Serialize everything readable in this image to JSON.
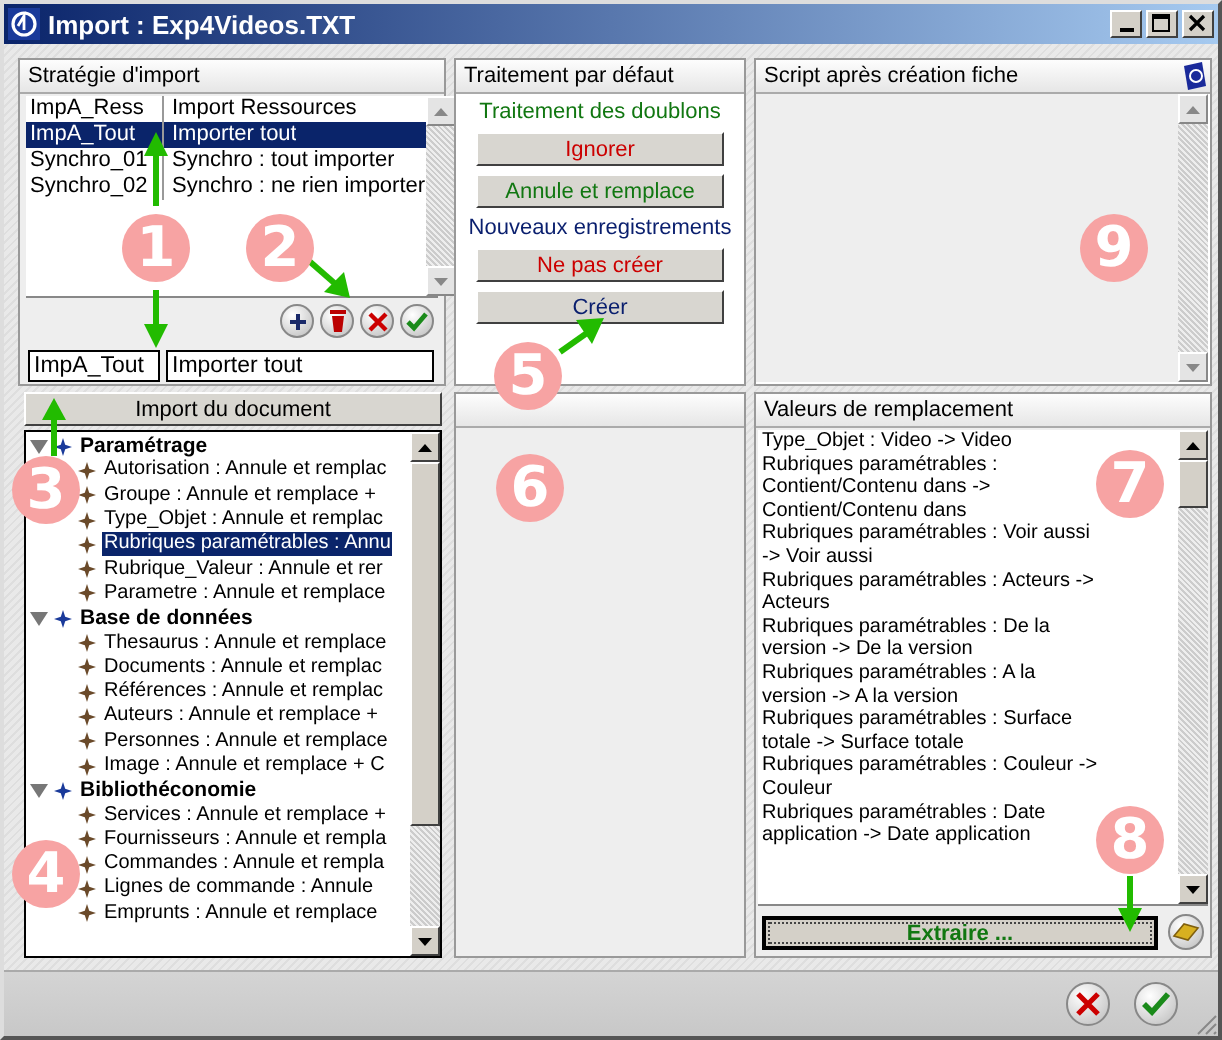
{
  "window": {
    "title": "Import : Exp4Videos.TXT"
  },
  "strategy": {
    "title": "Stratégie d'import",
    "rows": [
      {
        "code": "ImpA_Ress",
        "label": "Import Ressources",
        "selected": false
      },
      {
        "code": "ImpA_Tout",
        "label": "Importer tout",
        "selected": true
      },
      {
        "code": "Synchro_01",
        "label": "Synchro : tout importer",
        "selected": false
      },
      {
        "code": "Synchro_02",
        "label": "Synchro : ne rien importer",
        "selected": false
      }
    ],
    "code_field": {
      "value": "ImpA_Tout"
    },
    "label_field": {
      "value": "Importer tout"
    }
  },
  "defaults": {
    "title": "Traitement par défaut",
    "items": [
      {
        "kind": "label",
        "text": "Traitement des doublons",
        "color": "#117711"
      },
      {
        "kind": "button",
        "text": "Ignorer",
        "color": "#cc0000"
      },
      {
        "kind": "button",
        "text": "Annule et remplace",
        "color": "#117711"
      },
      {
        "kind": "label",
        "text": "Nouveaux enregistrements",
        "color": "#0a1f6e"
      },
      {
        "kind": "button",
        "text": "Ne pas créer",
        "color": "#cc0000"
      },
      {
        "kind": "button",
        "text": "Créer",
        "color": "#0a1f6e"
      }
    ]
  },
  "script": {
    "title": "Script après création fiche"
  },
  "import_button": "Import du document",
  "tree": [
    {
      "label": "Paramétrage",
      "expanded": true,
      "selected": false,
      "children": [
        {
          "label": "Autorisation : Annule et remplac",
          "selected": false
        },
        {
          "label": "Groupe : Annule et remplace +",
          "selected": false
        },
        {
          "label": "Type_Objet : Annule et remplac",
          "selected": false
        },
        {
          "label": "Rubriques paramétrables : Annu",
          "selected": true
        },
        {
          "label": "Rubrique_Valeur : Annule et rer",
          "selected": false
        },
        {
          "label": "Parametre : Annule et remplace",
          "selected": false
        }
      ]
    },
    {
      "label": "Base de données",
      "expanded": true,
      "selected": false,
      "children": [
        {
          "label": "Thesaurus : Annule et remplace",
          "selected": false
        },
        {
          "label": "Documents : Annule et remplac",
          "selected": false
        },
        {
          "label": "Références : Annule et remplac",
          "selected": false
        },
        {
          "label": "Auteurs : Annule et remplace +",
          "selected": false
        },
        {
          "label": "Personnes : Annule et remplace",
          "selected": false
        },
        {
          "label": "Image : Annule et remplace + C",
          "selected": false
        }
      ]
    },
    {
      "label": "Bibliothéconomie",
      "expanded": true,
      "selected": false,
      "children": [
        {
          "label": "Services : Annule et remplace +",
          "selected": false
        },
        {
          "label": "Fournisseurs : Annule et rempla",
          "selected": false
        },
        {
          "label": "Commandes : Annule et rempla",
          "selected": false
        },
        {
          "label": "Lignes de commande : Annule",
          "selected": false
        },
        {
          "label": "Emprunts : Annule et remplace",
          "selected": false
        }
      ]
    }
  ],
  "replacement": {
    "title": "Valeurs de remplacement",
    "values": [
      "Type_Objet : Video -> Video",
      "Rubriques paramétrables : Contient/Contenu dans -> Contient/Contenu dans",
      "Rubriques paramétrables : Voir aussi -> Voir aussi",
      "Rubriques paramétrables : Acteurs -> Acteurs",
      "Rubriques paramétrables : De la version -> De la version",
      "Rubriques paramétrables : A la version -> A la version",
      "Rubriques paramétrables : Surface totale -> Surface totale",
      "Rubriques paramétrables : Couleur -> Couleur",
      "Rubriques paramétrables : Date application -> Date application"
    ],
    "extract_button": "Extraire ..."
  },
  "callouts": [
    {
      "number": "1"
    },
    {
      "number": "2"
    },
    {
      "number": "5"
    },
    {
      "number": "9"
    },
    {
      "number": "3"
    },
    {
      "number": "6"
    },
    {
      "number": "7"
    },
    {
      "number": "4"
    },
    {
      "number": "8"
    }
  ]
}
